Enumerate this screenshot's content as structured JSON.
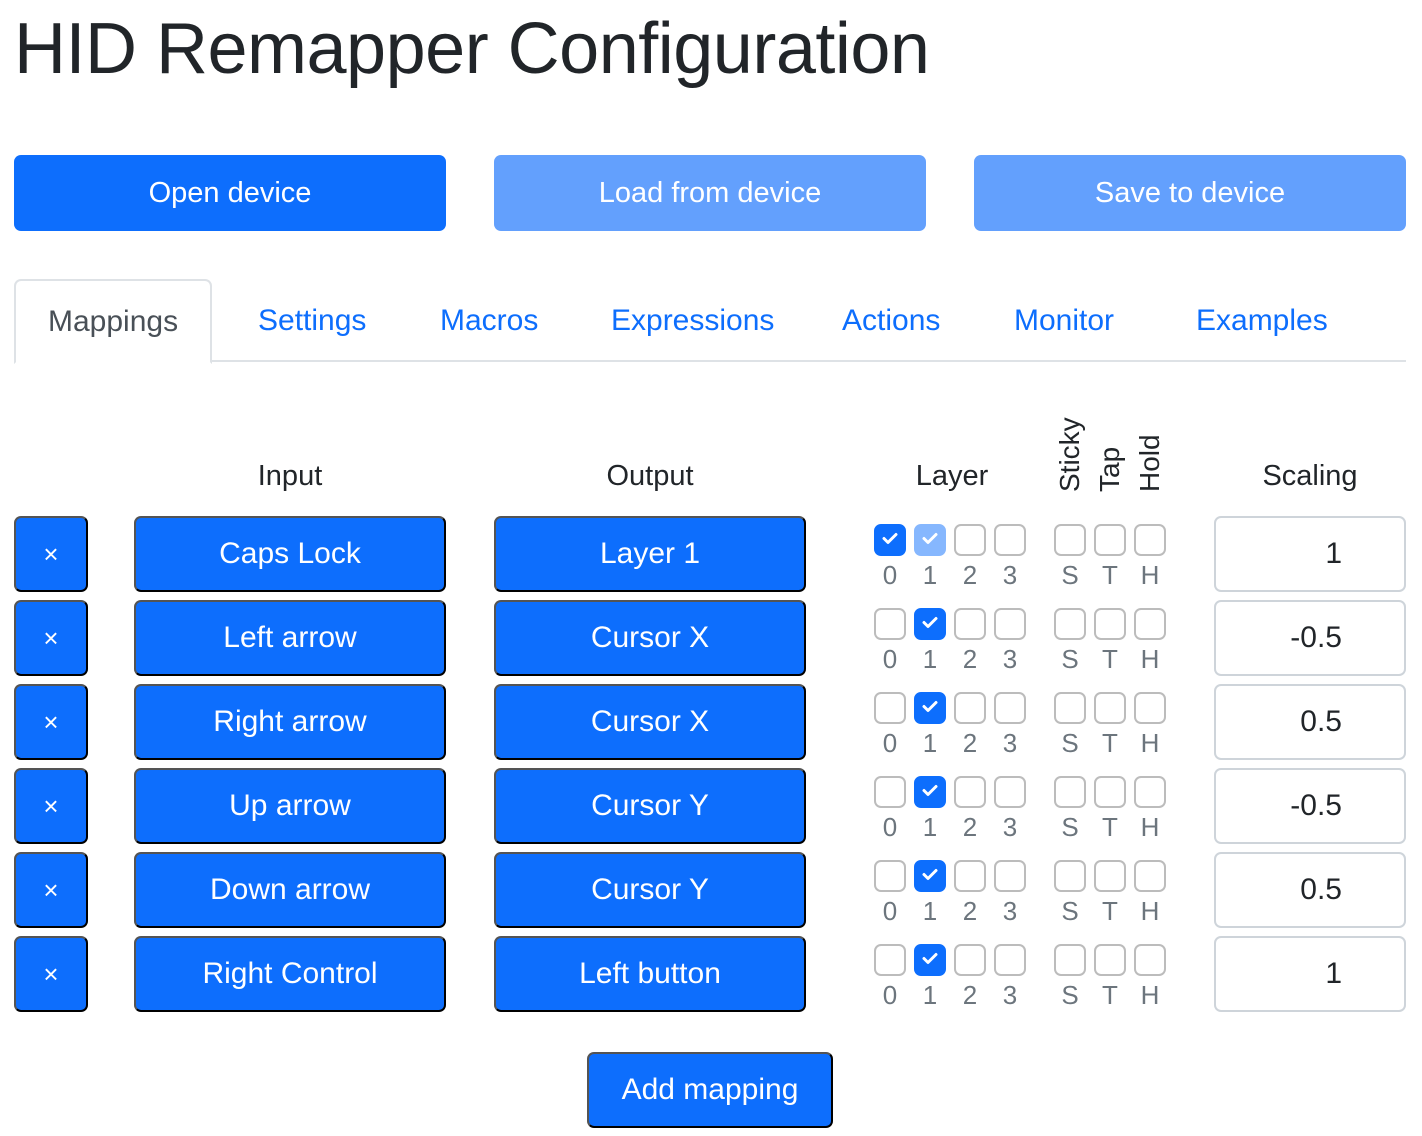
{
  "title": "HID Remapper Configuration",
  "toolbar": {
    "open": "Open device",
    "load": "Load from device",
    "save": "Save to device"
  },
  "tabs": [
    "Mappings",
    "Settings",
    "Macros",
    "Expressions",
    "Actions",
    "Monitor",
    "Examples"
  ],
  "active_tab": "Mappings",
  "headers": {
    "input": "Input",
    "output": "Output",
    "layer": "Layer",
    "sticky": "Sticky",
    "tap": "Tap",
    "hold": "Hold",
    "scaling": "Scaling"
  },
  "layer_labels": [
    "0",
    "1",
    "2",
    "3"
  ],
  "flag_labels": [
    "S",
    "T",
    "H"
  ],
  "delete_glyph": "×",
  "mappings": [
    {
      "input": "Caps Lock",
      "output": "Layer 1",
      "layers": [
        "on",
        "half",
        "off",
        "off"
      ],
      "flags": [
        "off",
        "off",
        "off"
      ],
      "scaling": "1"
    },
    {
      "input": "Left arrow",
      "output": "Cursor X",
      "layers": [
        "off",
        "on",
        "off",
        "off"
      ],
      "flags": [
        "off",
        "off",
        "off"
      ],
      "scaling": "-0.5"
    },
    {
      "input": "Right arrow",
      "output": "Cursor X",
      "layers": [
        "off",
        "on",
        "off",
        "off"
      ],
      "flags": [
        "off",
        "off",
        "off"
      ],
      "scaling": "0.5"
    },
    {
      "input": "Up arrow",
      "output": "Cursor Y",
      "layers": [
        "off",
        "on",
        "off",
        "off"
      ],
      "flags": [
        "off",
        "off",
        "off"
      ],
      "scaling": "-0.5"
    },
    {
      "input": "Down arrow",
      "output": "Cursor Y",
      "layers": [
        "off",
        "on",
        "off",
        "off"
      ],
      "flags": [
        "off",
        "off",
        "off"
      ],
      "scaling": "0.5"
    },
    {
      "input": "Right Control",
      "output": "Left button",
      "layers": [
        "off",
        "on",
        "off",
        "off"
      ],
      "flags": [
        "off",
        "off",
        "off"
      ],
      "scaling": "1"
    }
  ],
  "add_mapping": "Add mapping",
  "colors": {
    "primary": "#0d6efd",
    "disabled": "#63a0fd",
    "checked_disabled": "#86b7fe"
  }
}
